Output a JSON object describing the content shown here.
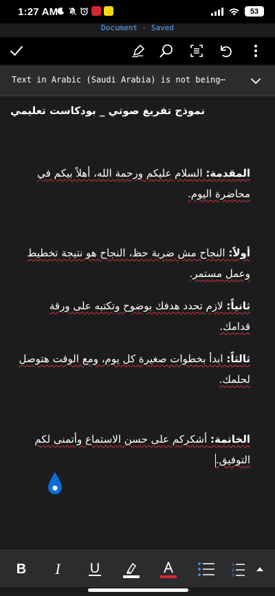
{
  "status_bar": {
    "time": "1:27 AM",
    "battery": "53",
    "signal_icon": "cellular-signal-icon",
    "wifi_icon": "wifi-icon"
  },
  "document_status": "Document - Saved",
  "toolbar": {
    "icons": [
      "checkmark-icon",
      "pen-icon",
      "search-icon",
      "reading-mode-icon",
      "undo-icon",
      "more-icon"
    ]
  },
  "banner": {
    "text": "Text in Arabic (Saudi Arabia) is not being⋯"
  },
  "document": {
    "title": "نموذج تفريغ صوتي _ بودكاست تعليمي",
    "paragraphs": [
      {
        "label": "المقدمة:",
        "text": " السلام عليكم ورحمة الله، أهلاً بيكم في محاضرة اليوم."
      },
      {
        "label": "أولاً:",
        "text": " النجاح مش ضربة حظ، النجاح هو نتيجة تخطيط وعمل مستمر."
      },
      {
        "label": "ثانياً:",
        "text": " لازم تحدد هدفك بوضوح وتكتبه على ورقة قدامك."
      },
      {
        "label": "ثالثاً:",
        "text": " ابدأ بخطوات صغيرة كل يوم، ومع الوقت هتوصل لحلمك."
      },
      {
        "label": "الخاتمة:",
        "text": " أشكركم على حسن الاستماع وأتمنى لكم التوفيق."
      }
    ]
  },
  "format_bar": {
    "bold": "B",
    "italic": "I",
    "underline": "U",
    "highlight_color": "#ffffff",
    "font_color": "#e3262f",
    "icons": [
      "bullets-icon",
      "numbering-icon",
      "expand-up-icon"
    ]
  },
  "colors": {
    "accent": "#5aa8ff",
    "background": "#1c1c1e",
    "spell_error": "#d63434",
    "cursor_handle": "#0a6fd6"
  }
}
